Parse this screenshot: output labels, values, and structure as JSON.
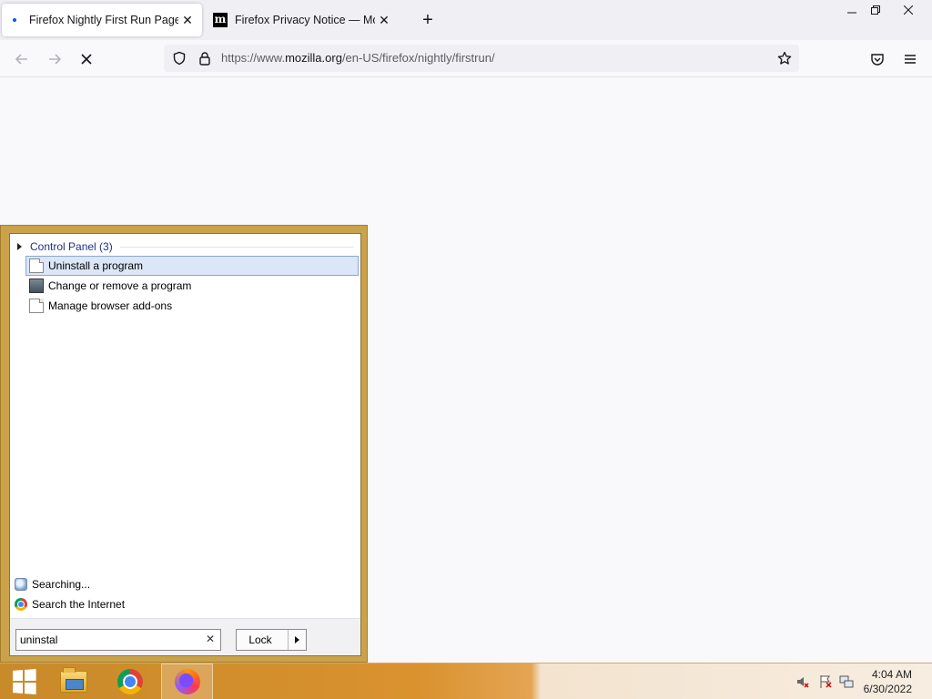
{
  "browser": {
    "tabs": [
      {
        "title": "Firefox Nightly First Run Page",
        "active": true,
        "favicon": "loading-dot-icon"
      },
      {
        "title": "Firefox Privacy Notice — Mozilla",
        "active": false,
        "favicon": "mozilla-m-icon"
      }
    ],
    "new_tab_label": "+",
    "url": {
      "scheme": "https://www.",
      "host": "mozilla.org",
      "path": "/en-US/firefox/nightly/firstrun/"
    },
    "window_controls": [
      "minimize",
      "restore",
      "close"
    ]
  },
  "start_menu": {
    "group_title": "Control Panel (3)",
    "results": [
      {
        "label": "Uninstall a program",
        "icon": "document-icon",
        "selected": true
      },
      {
        "label": "Change or remove a program",
        "icon": "program-icon",
        "selected": false
      },
      {
        "label": "Manage browser add-ons",
        "icon": "document-icon",
        "selected": false
      }
    ],
    "searching_label": "Searching...",
    "search_internet_label": "Search the Internet",
    "search_value": "uninstal",
    "clear_glyph": "✕",
    "power_button_label": "Lock"
  },
  "taskbar": {
    "pinned": [
      "windows-start",
      "file-explorer",
      "chrome",
      "firefox-nightly"
    ],
    "active_app": "firefox-nightly",
    "tray": [
      "volume-muted-icon",
      "action-center-flag-icon",
      "network-icon"
    ],
    "time": "4:04 AM",
    "date": "6/30/2022"
  }
}
